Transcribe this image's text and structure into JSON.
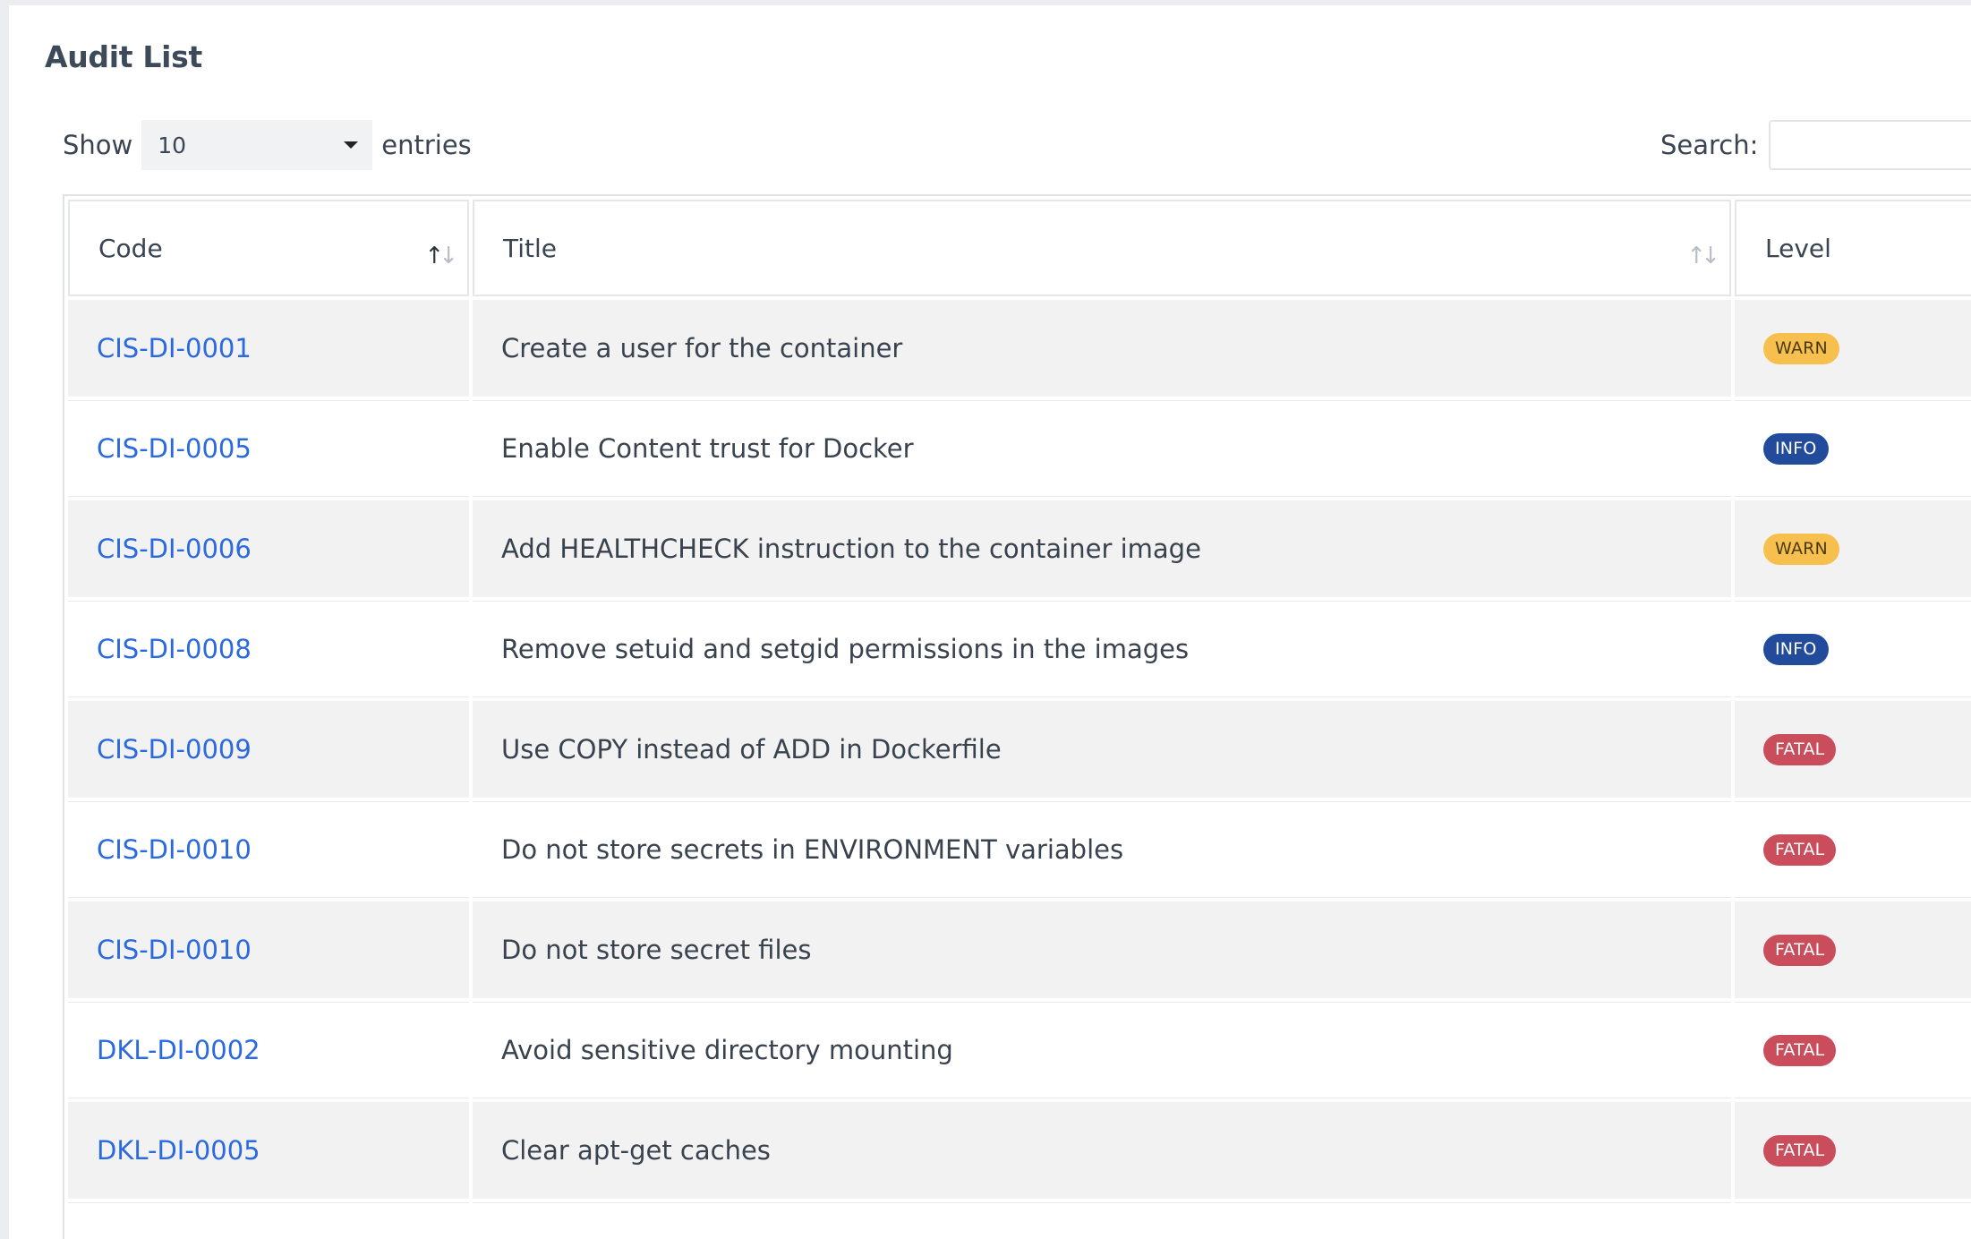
{
  "card": {
    "title": "Audit List"
  },
  "length": {
    "prefix": "Show",
    "selected": "10",
    "suffix": "entries"
  },
  "search": {
    "label": "Search:",
    "value": "",
    "placeholder": ""
  },
  "table": {
    "headers": {
      "code": "Code",
      "title": "Title",
      "level": "Level"
    },
    "rows": [
      {
        "code": "CIS-DI-0001",
        "title": "Create a user for the container",
        "level": "WARN"
      },
      {
        "code": "CIS-DI-0005",
        "title": "Enable Content trust for Docker",
        "level": "INFO"
      },
      {
        "code": "CIS-DI-0006",
        "title": "Add HEALTHCHECK instruction to the container image",
        "level": "WARN"
      },
      {
        "code": "CIS-DI-0008",
        "title": "Remove setuid and setgid permissions in the images",
        "level": "INFO"
      },
      {
        "code": "CIS-DI-0009",
        "title": "Use COPY instead of ADD in Dockerfile",
        "level": "FATAL"
      },
      {
        "code": "CIS-DI-0010",
        "title": "Do not store secrets in ENVIRONMENT variables",
        "level": "FATAL"
      },
      {
        "code": "CIS-DI-0010",
        "title": "Do not store secret files",
        "level": "FATAL"
      },
      {
        "code": "DKL-DI-0002",
        "title": "Avoid sensitive directory mounting",
        "level": "FATAL"
      },
      {
        "code": "DKL-DI-0005",
        "title": "Clear apt-get caches",
        "level": "FATAL"
      },
      {
        "code": "",
        "title": "",
        "level": ""
      }
    ]
  },
  "colors": {
    "link": "#2a69e0",
    "warn": "#f7c04e",
    "info": "#234b9c",
    "fatal": "#c94d5b",
    "stripe": "#f2f2f2"
  },
  "icons": {
    "sort": "sort-arrows-icon",
    "dropdown": "caret-down-icon"
  }
}
